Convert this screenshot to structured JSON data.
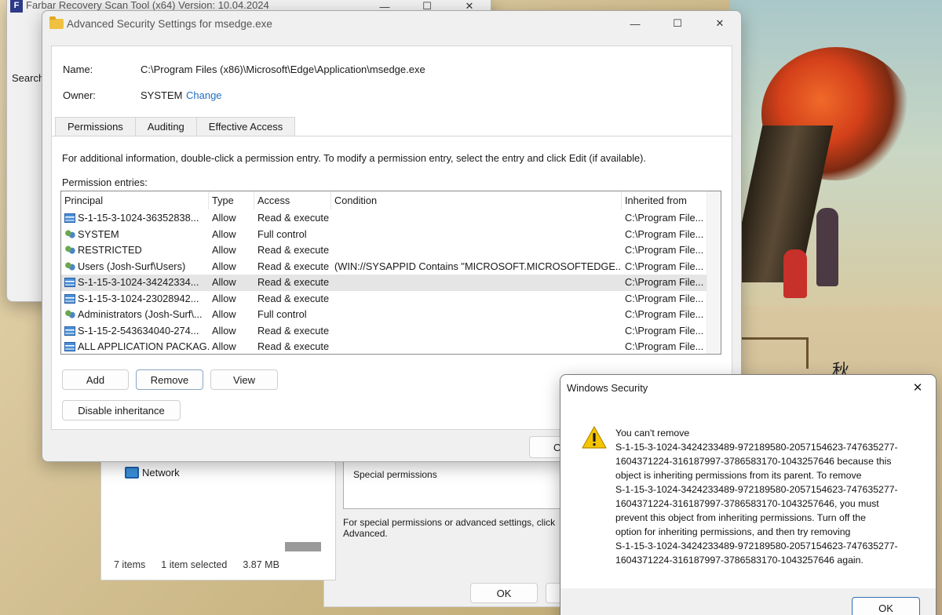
{
  "farbar": {
    "title": "Farbar Recovery Scan Tool (x64) Version: 10.04.2024",
    "icon_letter": "F",
    "search_label": "Search"
  },
  "explorer": {
    "network_label": "Network",
    "items_count": "7 items",
    "selection": "1 item selected",
    "size": "3.87 MB"
  },
  "properties": {
    "box_text": "Special permissions",
    "note": "For special permissions or advanced settings, click Advanced.",
    "ok_label": "OK"
  },
  "advanced": {
    "title": "Advanced Security Settings for msedge.exe",
    "name_label": "Name:",
    "name_value": "C:\\Program Files (x86)\\Microsoft\\Edge\\Application\\msedge.exe",
    "owner_label": "Owner:",
    "owner_value": "SYSTEM",
    "change_link": "Change",
    "tabs": [
      "Permissions",
      "Auditing",
      "Effective Access"
    ],
    "info_text": "For additional information, double-click a permission entry. To modify a permission entry, select the entry and click Edit (if available).",
    "entries_label": "Permission entries:",
    "columns": [
      "Principal",
      "Type",
      "Access",
      "Condition",
      "Inherited from"
    ],
    "rows": [
      {
        "principal": "S-1-15-3-1024-36352838...",
        "icon": "sid-icon",
        "type": "Allow",
        "access": "Read & execute",
        "condition": "",
        "inherited": "C:\\Program File..."
      },
      {
        "principal": "SYSTEM",
        "icon": "group-icon",
        "type": "Allow",
        "access": "Full control",
        "condition": "",
        "inherited": "C:\\Program File..."
      },
      {
        "principal": "RESTRICTED",
        "icon": "group-icon",
        "type": "Allow",
        "access": "Read & execute",
        "condition": "",
        "inherited": "C:\\Program File..."
      },
      {
        "principal": "Users (Josh-Surf\\Users)",
        "icon": "group-icon",
        "type": "Allow",
        "access": "Read & execute",
        "condition": "(WIN://SYSAPPID Contains \"MICROSOFT.MICROSOFTEDGE...",
        "inherited": "C:\\Program File..."
      },
      {
        "principal": "S-1-15-3-1024-34242334...",
        "icon": "sid-icon",
        "type": "Allow",
        "access": "Read & execute",
        "condition": "",
        "inherited": "C:\\Program File..."
      },
      {
        "principal": "S-1-15-3-1024-23028942...",
        "icon": "sid-icon",
        "type": "Allow",
        "access": "Read & execute",
        "condition": "",
        "inherited": "C:\\Program File..."
      },
      {
        "principal": "Administrators (Josh-Surf\\...",
        "icon": "group-icon",
        "type": "Allow",
        "access": "Full control",
        "condition": "",
        "inherited": "C:\\Program File..."
      },
      {
        "principal": "S-1-15-2-543634040-274...",
        "icon": "sid-icon",
        "type": "Allow",
        "access": "Read & execute",
        "condition": "",
        "inherited": "C:\\Program File..."
      },
      {
        "principal": "ALL APPLICATION PACKAG...",
        "icon": "sid-icon",
        "type": "Allow",
        "access": "Read & execute",
        "condition": "",
        "inherited": "C:\\Program File..."
      }
    ],
    "selected_row": 4,
    "add_label": "Add",
    "remove_label": "Remove",
    "view_label": "View",
    "disable_label": "Disable inheritance",
    "ok_label": "O"
  },
  "security": {
    "title": "Windows Security",
    "message_lines": [
      "You can't remove",
      "S-1-15-3-1024-3424233489-972189580-2057154623-747635277-",
      "1604371224-316187997-3786583170-1043257646 because this",
      "object is inheriting permissions from its parent. To remove",
      "S-1-15-3-1024-3424233489-972189580-2057154623-747635277-",
      "1604371224-316187997-3786583170-1043257646, you must",
      "prevent this object from inheriting permissions.  Turn off the",
      "option for inheriting permissions, and then try removing",
      "S-1-15-3-1024-3424233489-972189580-2057154623-747635277-",
      "1604371224-316187997-3786583170-1043257646 again."
    ],
    "ok_label": "OK"
  },
  "art": {
    "kanji": "秋"
  },
  "colors": {
    "link": "#1f6fbf",
    "selection": "#e5e5e5",
    "warning": "#f5c400"
  }
}
